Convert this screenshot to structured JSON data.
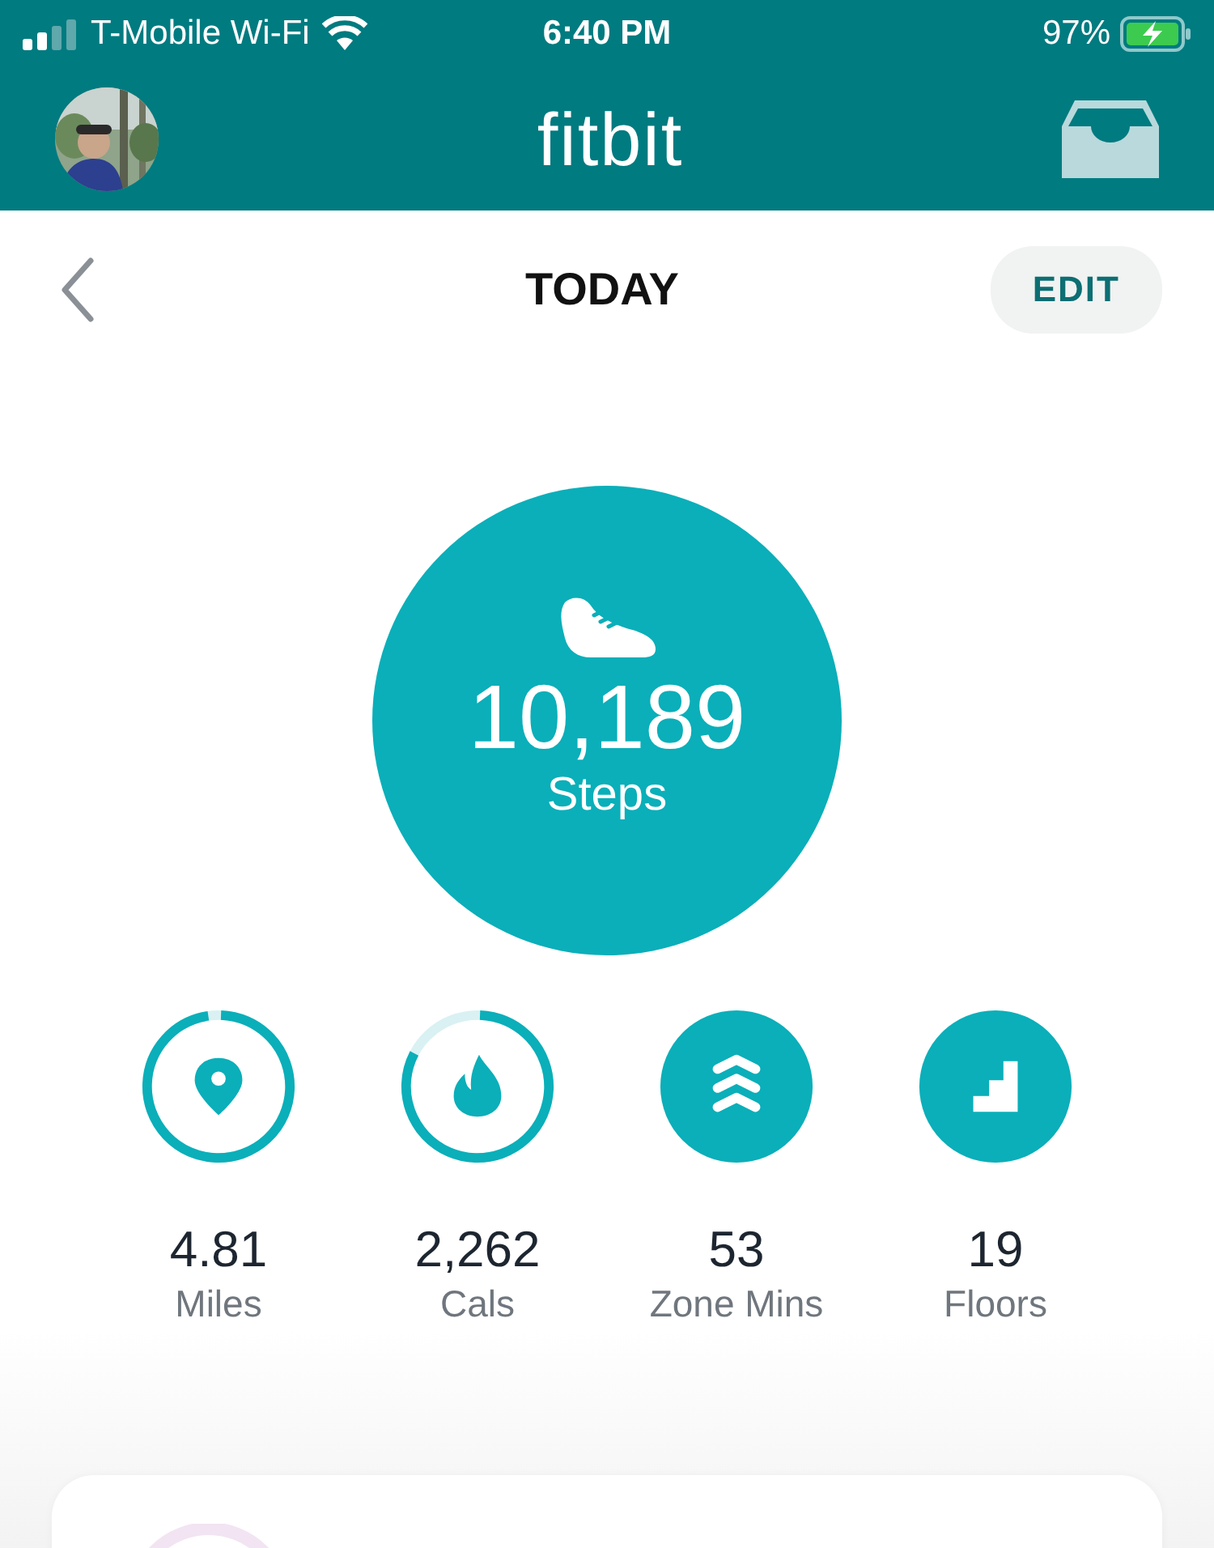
{
  "status_bar": {
    "carrier": "T-Mobile Wi-Fi",
    "time": "6:40 PM",
    "battery": "97%"
  },
  "header": {
    "title": "fitbit"
  },
  "page": {
    "title": "TODAY",
    "edit_button": "EDIT"
  },
  "steps": {
    "value": "10,189",
    "label": "Steps"
  },
  "stats": [
    {
      "kind": "distance",
      "value": "4.81",
      "label": "Miles",
      "goal_met": false
    },
    {
      "kind": "calories",
      "value": "2,262",
      "label": "Cals",
      "goal_met": false
    },
    {
      "kind": "zone",
      "value": "53",
      "label": "Zone Mins",
      "goal_met": true
    },
    {
      "kind": "floors",
      "value": "19",
      "label": "Floors",
      "goal_met": true
    }
  ]
}
